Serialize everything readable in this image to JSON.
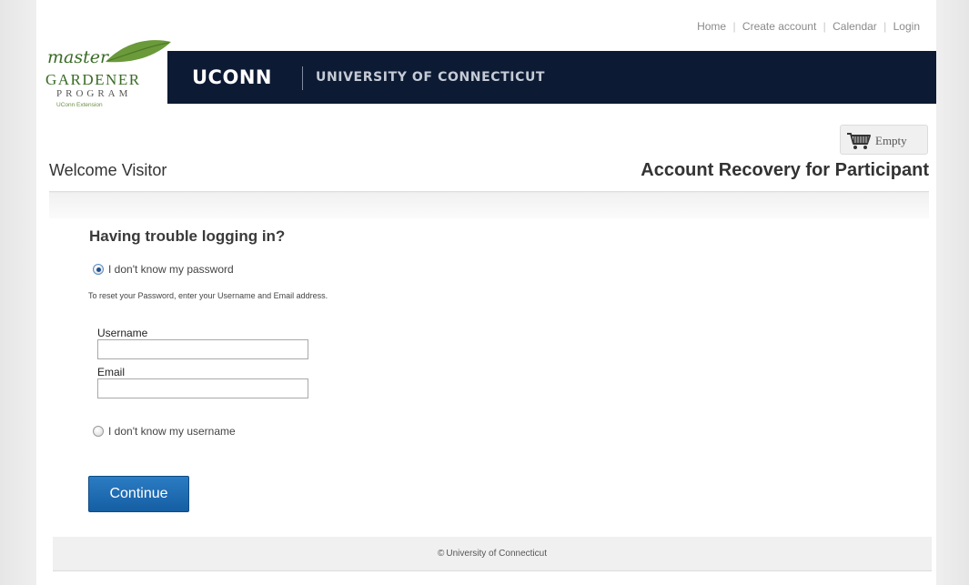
{
  "toplinks": {
    "home": "Home",
    "create_account": "Create account",
    "calendar": "Calendar",
    "login": "Login",
    "separator": "|"
  },
  "logo": {
    "master": "master",
    "gardener": "GARDENER",
    "program": "PROGRAM",
    "extension": "UConn Extension"
  },
  "banner": {
    "brand": "UCONN",
    "university": "UNIVERSITY OF CONNECTICUT",
    "bg_color": "#0d1a33"
  },
  "cart": {
    "icon": "shopping-cart-icon",
    "label": "Empty"
  },
  "welcome": "Welcome Visitor",
  "page_title": "Account Recovery for Participant",
  "form": {
    "heading": "Having trouble logging in?",
    "option_password": "I don't know my password",
    "option_password_selected": true,
    "hint": "To reset your Password, enter your Username and Email address.",
    "username_label": "Username",
    "username_value": "",
    "email_label": "Email",
    "email_value": "",
    "option_username": "I don't know my username",
    "option_username_selected": false,
    "continue_label": "Continue",
    "button_color": "#1f6fb5"
  },
  "footer": {
    "copyright_symbol": "©",
    "text": "University of Connecticut"
  }
}
